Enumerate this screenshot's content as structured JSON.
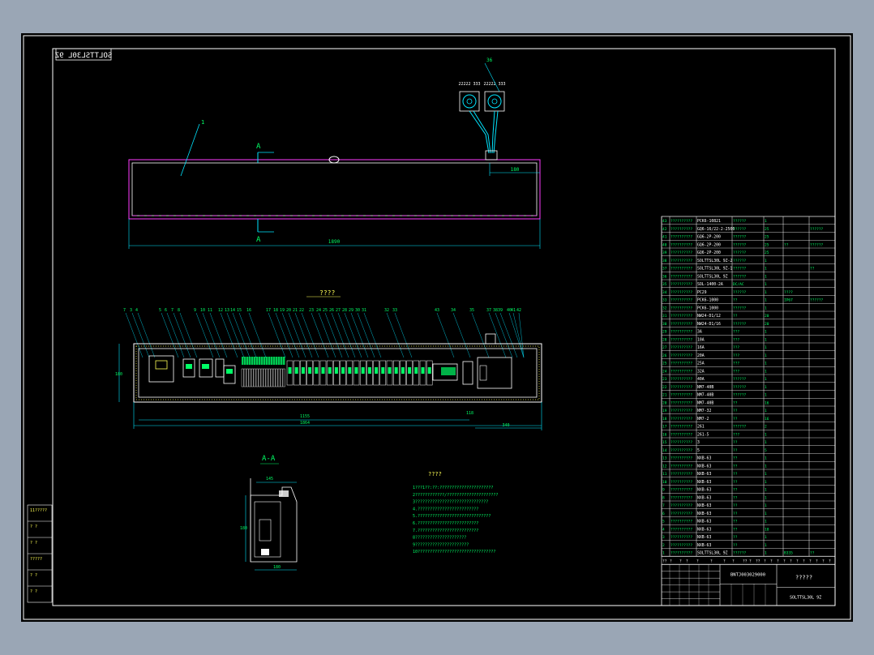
{
  "colors": {
    "background": "#000000",
    "frame": "#ffffff",
    "cyan": "#00e5ff",
    "green": "#00ff66",
    "magenta": "#ff3cff",
    "yellow": "#ffff55",
    "red": "#ff3030"
  },
  "drawing": {
    "corner_code": "SOLTTSL30L 9Z",
    "part_label": "1",
    "section_mark": "A",
    "top_dim": "1890",
    "right_dim": "180",
    "fan_callout": "36",
    "fan_label_left": "22222 333",
    "fan_label_right": "22222 333",
    "view_title": "????",
    "callouts": [
      "7",
      "3",
      "4",
      "5",
      "6",
      "7",
      "8",
      "9",
      "10",
      "11",
      "12",
      "13",
      "14",
      "15",
      "16",
      "17",
      "18",
      "19",
      "20",
      "21",
      "22",
      "23",
      "24",
      "25",
      "26",
      "27",
      "28",
      "29",
      "30",
      "31",
      "32",
      "33",
      "43",
      "34",
      "35",
      "37",
      "38",
      "39",
      "40",
      "41",
      "42"
    ],
    "panel_dims": {
      "left": "180",
      "overall": "1864",
      "inner": "1155",
      "small": "118",
      "right": "340"
    },
    "section_title": "A-A",
    "section_dims": {
      "top": "145",
      "left": "180",
      "bottom": "180"
    },
    "notes_title": "????",
    "notes": [
      "1???1??:??:??????????????????????",
      "2????????????/?????????????????????",
      "3??????????????????????????????",
      "4.?????????????????????????",
      "5.??????????????????????????????",
      "6.?????????????????????????",
      "7.?????????????????????????",
      "8?????????????????????",
      "9??????????????????????",
      "10????????????????????????????????"
    ]
  },
  "left_strip": [
    "11?????",
    "? ?",
    "? ?",
    "?????",
    "? ?",
    "? ?"
  ],
  "bom": {
    "rows": [
      [
        "43",
        "??????????",
        "PCK6-10821",
        "??????",
        "1",
        "",
        ""
      ],
      [
        "42",
        "??????????",
        "GQ6-16/22-2-2500",
        "??????",
        "25",
        "",
        "??????"
      ],
      [
        "41",
        "??????????",
        "GQ6-2P-200",
        "??????",
        "25",
        "",
        ""
      ],
      [
        "40",
        "??????????",
        "GQ6-2P-200",
        "??????",
        "25",
        "??",
        "??????"
      ],
      [
        "39",
        "??????????",
        "GQ6-2P-200",
        "??????",
        "25",
        "",
        ""
      ],
      [
        "38",
        "??????????",
        "SOLTTSL30L 9Z-2",
        "??????",
        "1",
        "",
        ""
      ],
      [
        "37",
        "??????????",
        "SOLTTSL30L 9Z-1",
        "??????",
        "1",
        "",
        "??"
      ],
      [
        "36",
        "??????????",
        "SOLTTSL30L 9Z",
        "??????",
        "1",
        "",
        ""
      ],
      [
        "35",
        "??????????",
        "SOL-1400-2A",
        "DC/AC",
        "1",
        "",
        ""
      ],
      [
        "34",
        "??????????",
        "PC29",
        "??????",
        "1",
        "????",
        ""
      ],
      [
        "33",
        "??????????",
        "PCK6-1000",
        "??",
        "1",
        "IP67",
        "??????"
      ],
      [
        "32",
        "??????????",
        "PCK6-1000",
        "??????",
        "1",
        "",
        ""
      ],
      [
        "31",
        "??????????",
        "NW24-D1/12",
        "??",
        "20",
        "",
        ""
      ],
      [
        "30",
        "??????????",
        "NW24-D1/16",
        "??????",
        "20",
        "",
        ""
      ],
      [
        "29",
        "??????????",
        "3A",
        "???",
        "1",
        "",
        ""
      ],
      [
        "28",
        "??????????",
        "10A",
        "???",
        "1",
        "",
        ""
      ],
      [
        "27",
        "??????????",
        "16A",
        "???",
        "1",
        "",
        ""
      ],
      [
        "26",
        "??????????",
        "20A",
        "???",
        "1",
        "",
        ""
      ],
      [
        "25",
        "??????????",
        "25A",
        "???",
        "1",
        "",
        ""
      ],
      [
        "24",
        "??????????",
        "32A",
        "???",
        "1",
        "",
        ""
      ],
      [
        "23",
        "??????????",
        "40A",
        "??????",
        "1",
        "",
        ""
      ],
      [
        "22",
        "??????????",
        "NM7-40B",
        "??????",
        "1",
        "",
        ""
      ],
      [
        "21",
        "??????????",
        "NM7-40B",
        "??????",
        "1",
        "",
        ""
      ],
      [
        "20",
        "??????????",
        "NM7-40B",
        "??",
        "16",
        "",
        ""
      ],
      [
        "19",
        "??????????",
        "NM7-32",
        "??",
        "1",
        "",
        ""
      ],
      [
        "18",
        "??????????",
        "NM7-2",
        "??",
        "16",
        "",
        ""
      ],
      [
        "17",
        "??????????",
        "261",
        "??????",
        "2",
        "",
        ""
      ],
      [
        "16",
        "??????????",
        "261-5",
        "???",
        "1",
        "",
        ""
      ],
      [
        "15",
        "??????????",
        "3",
        "??",
        "1",
        "",
        ""
      ],
      [
        "14",
        "??????????",
        "5",
        "??",
        "5",
        "",
        ""
      ],
      [
        "13",
        "??????????",
        "NXB-63",
        "??",
        "1",
        "",
        ""
      ],
      [
        "12",
        "??????????",
        "NXB-63",
        "??",
        "1",
        "",
        ""
      ],
      [
        "11",
        "??????????",
        "NXB-63",
        "??",
        "1",
        "",
        ""
      ],
      [
        "10",
        "??????????",
        "NXB-63",
        "??",
        "1",
        "",
        ""
      ],
      [
        "9",
        "??????????",
        "NXB-63",
        "??",
        "1",
        "",
        ""
      ],
      [
        "8",
        "??????????",
        "NXB-63",
        "??",
        "1",
        "",
        ""
      ],
      [
        "7",
        "??????????",
        "NXB-63",
        "??",
        "1",
        "",
        ""
      ],
      [
        "6",
        "??????????",
        "NXB-63",
        "??",
        "1",
        "",
        ""
      ],
      [
        "5",
        "??????????",
        "NXB-63",
        "??",
        "1",
        "",
        ""
      ],
      [
        "4",
        "??????????",
        "NXB-63",
        "??",
        "10",
        "",
        ""
      ],
      [
        "3",
        "??????????",
        "NXB-63",
        "??",
        "1",
        "",
        ""
      ],
      [
        "2",
        "??????????",
        "NXB-63",
        "??",
        "1",
        "",
        ""
      ],
      [
        "1",
        "??????????",
        "SOLTTSL30L 9Z",
        "??????",
        "1",
        "B335",
        "??"
      ]
    ],
    "header": [
      "??",
      "?",
      "?",
      "?",
      "?",
      "?",
      "?",
      "?",
      "??",
      "?",
      "??",
      "?",
      "?",
      "?",
      "?",
      "?",
      "?",
      "?",
      "?",
      "?",
      "?",
      "?",
      "?",
      "?"
    ],
    "title_block": {
      "code": "BNTJ003029000",
      "name": "?????",
      "drawing_no": "SOLTTSL30L 9Z"
    }
  }
}
